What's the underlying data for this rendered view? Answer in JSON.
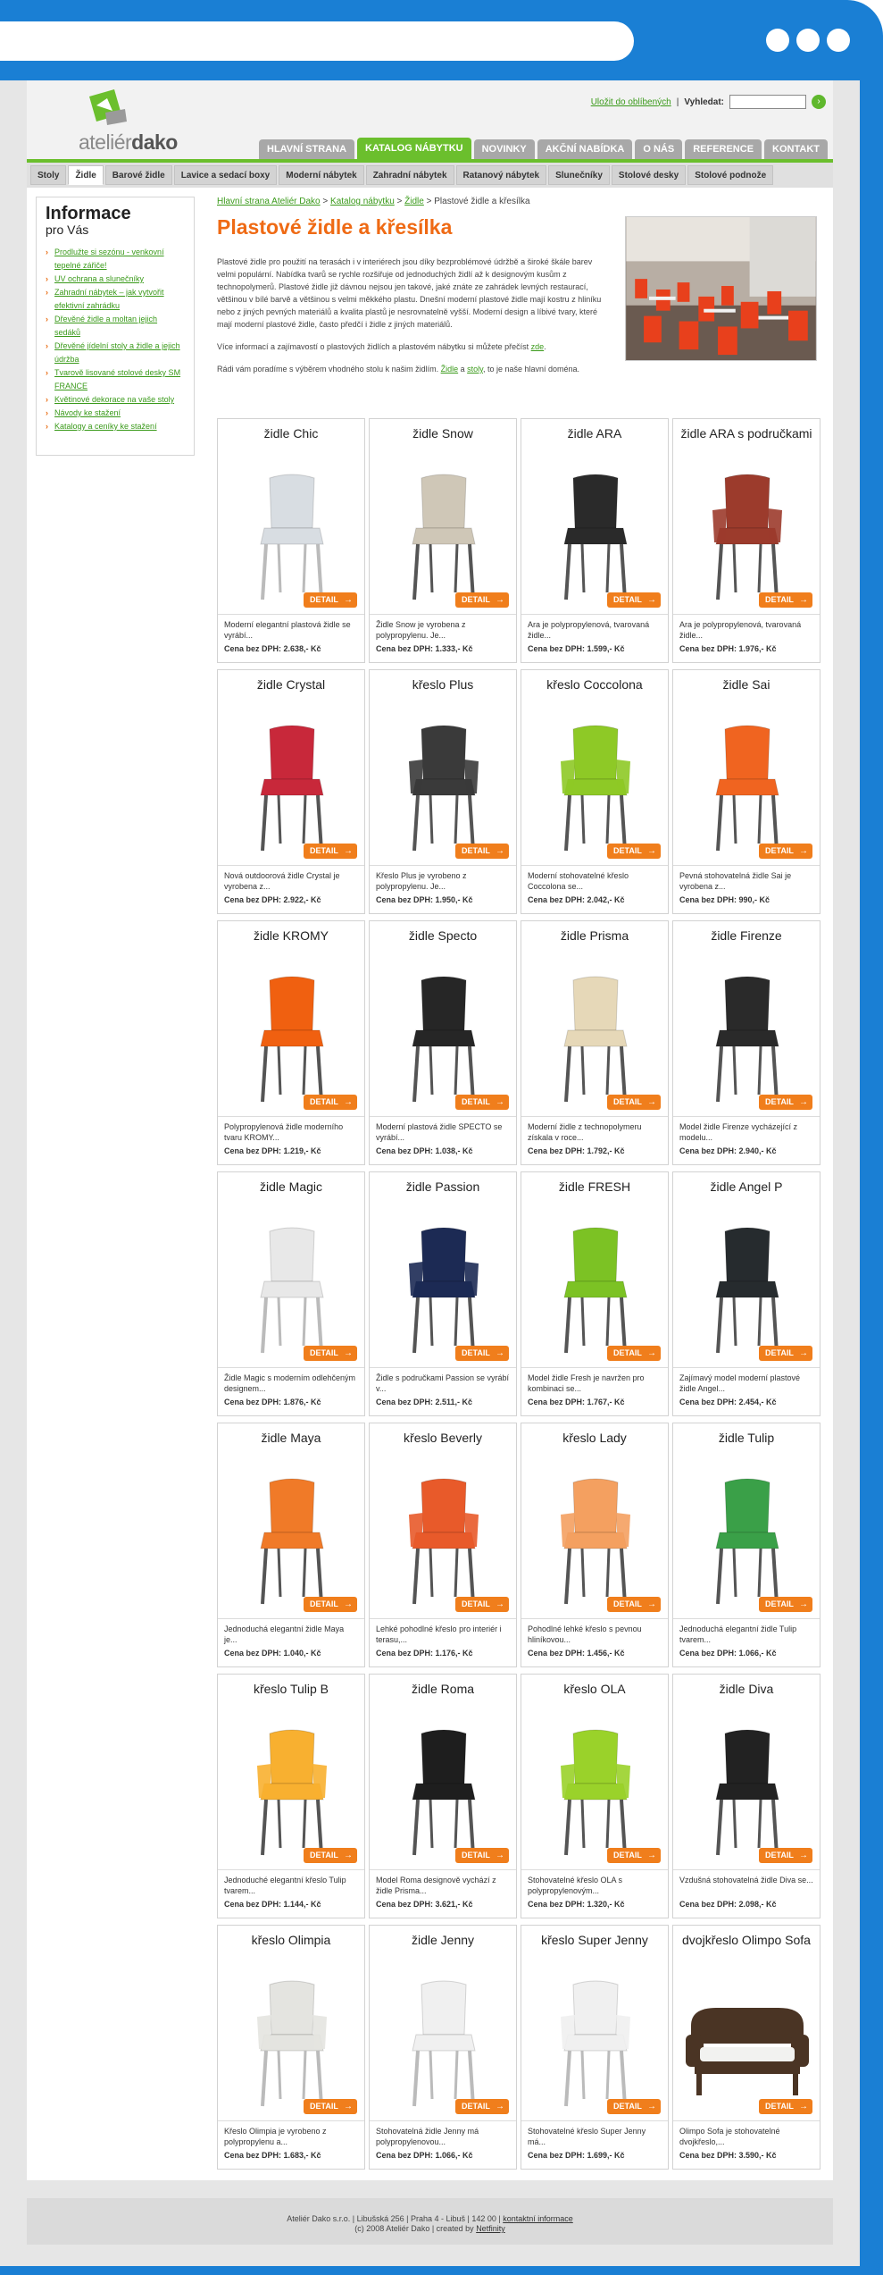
{
  "header": {
    "logo_part1": "ateliér",
    "logo_part2": "dako",
    "favorites_link": "Uložit do oblíbených",
    "separator": "|",
    "search_label": "Vyhledat:",
    "search_button": "›"
  },
  "main_nav": [
    "HLAVNÍ STRANA",
    "KATALOG NÁBYTKU",
    "NOVINKY",
    "AKČNÍ NABÍDKA",
    "O NÁS",
    "REFERENCE",
    "KONTAKT"
  ],
  "main_nav_active": "KATALOG NÁBYTKU",
  "sub_nav": [
    "Stoly",
    "Židle",
    "Barové židle",
    "Lavice a sedací boxy",
    "Moderní nábytek",
    "Zahradní nábytek",
    "Ratanový nábytek",
    "Slunečníky",
    "Stolové desky",
    "Stolové podnože"
  ],
  "sub_nav_active": "Židle",
  "sidebar": {
    "title": "Informace",
    "subtitle": "pro Vás",
    "links": [
      "Prodlužte si sezónu - venkovní tepelné zářiče!",
      "UV ochrana a slunečníky",
      "Zahradní nábytek – jak vytvořit efektivní zahrádku",
      "Dřevěné židle a moltan jejich sedáků",
      "Dřevěné jídelní stoly a židle a jejich údržba",
      "Tvarově lisované stolové desky SM FRANCE",
      "Květinové dekorace na vaše stoly",
      "Návody ke stažení",
      "Katalogy a ceníky ke stažení"
    ]
  },
  "breadcrumb": {
    "home": "Hlavní strana Ateliér Dako",
    "catalog": "Katalog nábytku",
    "category": "Židle",
    "current": "Plastové židle a křesílka",
    "sep": ">"
  },
  "page_title": "Plastové židle a křesílka",
  "intro": {
    "p1": "Plastové židle pro použití na terasách i v interiérech jsou díky bezproblémové údržbě a široké škále barev velmi populární. Nabídka tvarů se rychle rozšiřuje od jednoduchých židlí až k designovým kusům z technopolymerů. Plastové židle již dávnou nejsou jen takové, jaké znáte ze zahrádek levných restaurací, většinou v bílé barvě a většinou s velmi měkkého plastu. Dnešní moderní plastové židle mají kostru z hliníku nebo z jiných pevných materiálů a kvalita plastů je nesrovnatelně vyšší. Moderní design a líbivé tvary, které mají moderní plastové židle, často předčí i židle z jiných materiálů.",
    "p2_text": "Více informací a zajímavostí o plastových židlích a plastovém nábytku si můžete přečíst ",
    "p2_link": "zde",
    "p3_text": "Rádi vám poradíme s výběrem vhodného stolu k našim židlím. ",
    "p3_link1": "Židle",
    "p3_mid": " a ",
    "p3_link2": "stoly",
    "p3_end": ", to je naše hlavní doména."
  },
  "detail_label": "DETAIL",
  "price_label": "Cena bez DPH:",
  "products": [
    {
      "name": "židle Chic",
      "desc": "Moderní elegantní plastová židle se vyrábí...",
      "price": "2.638,- Kč",
      "color": "#d8dde2",
      "shape": "chair"
    },
    {
      "name": "židle Snow",
      "desc": "Židle Snow je vyrobena z polypropylenu. Je...",
      "price": "1.333,- Kč",
      "color": "#cfc7b7",
      "shape": "chair"
    },
    {
      "name": "židle ARA",
      "desc": "Ara je polypropylenová, tvarovaná židle...",
      "price": "1.599,- Kč",
      "color": "#2a2a2a",
      "shape": "chair"
    },
    {
      "name": "židle ARA s područkami",
      "desc": "Ara je polypropylenová, tvarovaná židle...",
      "price": "1.976,- Kč",
      "color": "#9c3b2c",
      "shape": "armchair"
    },
    {
      "name": "židle Crystal",
      "desc": "Nová outdoorová židle Crystal je vyrobena z...",
      "price": "2.922,- Kč",
      "color": "#c8283a",
      "shape": "chair"
    },
    {
      "name": "křeslo Plus",
      "desc": "Křeslo Plus je vyrobeno z polypropylenu. Je...",
      "price": "1.950,- Kč",
      "color": "#3a3a3a",
      "shape": "armchair"
    },
    {
      "name": "křeslo Coccolona",
      "desc": "Moderní stohovatelné křeslo Coccolona se...",
      "price": "2.042,- Kč",
      "color": "#8ec926",
      "shape": "armchair"
    },
    {
      "name": "židle Sai",
      "desc": "Pevná stohovatelná židle Sai je vyrobena z...",
      "price": "990,- Kč",
      "color": "#f06420",
      "shape": "chair"
    },
    {
      "name": "židle KROMY",
      "desc": "Polypropylenová židle moderního tvaru KROMY...",
      "price": "1.219,- Kč",
      "color": "#f06010",
      "shape": "chair"
    },
    {
      "name": "židle Specto",
      "desc": "Moderní plastová židle SPECTO se vyrábí...",
      "price": "1.038,- Kč",
      "color": "#262626",
      "shape": "chair"
    },
    {
      "name": "židle Prisma",
      "desc": "Moderní židle z technopolymeru získala v roce...",
      "price": "1.792,- Kč",
      "color": "#e6d8b8",
      "shape": "chair"
    },
    {
      "name": "židle Firenze",
      "desc": "Model židle Firenze vycházející z modelu...",
      "price": "2.940,- Kč",
      "color": "#2a2a2a",
      "shape": "chair"
    },
    {
      "name": "židle Magic",
      "desc": "Židle Magic s moderním odlehčeným designem...",
      "price": "1.876,- Kč",
      "color": "#e8e8e8",
      "shape": "chair"
    },
    {
      "name": "židle Passion",
      "desc": "Židle s područkami Passion se vyrábí v...",
      "price": "2.511,- Kč",
      "color": "#1c2a54",
      "shape": "armchair"
    },
    {
      "name": "židle FRESH",
      "desc": "Model židle Fresh je navržen pro kombinaci se...",
      "price": "1.767,- Kč",
      "color": "#7cc224",
      "shape": "chair"
    },
    {
      "name": "židle Angel P",
      "desc": "Zajímavý model moderní plastové židle Angel...",
      "price": "2.454,- Kč",
      "color": "#262b2e",
      "shape": "chair"
    },
    {
      "name": "židle Maya",
      "desc": "Jednoduchá elegantní židle Maya je...",
      "price": "1.040,- Kč",
      "color": "#f07a28",
      "shape": "chair"
    },
    {
      "name": "křeslo Beverly",
      "desc": "Lehké pohodlné křeslo pro interiér i terasu,...",
      "price": "1.176,- Kč",
      "color": "#e85a2a",
      "shape": "armchair"
    },
    {
      "name": "křeslo Lady",
      "desc": "Pohodlné lehké křeslo s pevnou hliníkovou...",
      "price": "1.456,- Kč",
      "color": "#f4a060",
      "shape": "armchair"
    },
    {
      "name": "židle Tulip",
      "desc": "Jednoduchá elegantní židle Tulip tvarem...",
      "price": "1.066,- Kč",
      "color": "#3aa048",
      "shape": "chair"
    },
    {
      "name": "křeslo Tulip B",
      "desc": "Jednoduché elegantní křeslo Tulip tvarem...",
      "price": "1.144,- Kč",
      "color": "#f8b030",
      "shape": "armchair"
    },
    {
      "name": "židle Roma",
      "desc": "Model Roma designově vychází z židle Prisma...",
      "price": "3.621,- Kč",
      "color": "#1e1e1e",
      "shape": "chair"
    },
    {
      "name": "křeslo OLA",
      "desc": "Stohovatelné křeslo OLA s polypropylenovým...",
      "price": "1.320,- Kč",
      "color": "#9ad22a",
      "shape": "armchair"
    },
    {
      "name": "židle Diva",
      "desc": "Vzdušná stohovatelná židle Diva se...",
      "price": "2.098,- Kč",
      "color": "#222222",
      "shape": "chair"
    },
    {
      "name": "křeslo Olimpia",
      "desc": "Křeslo Olimpia je vyrobeno z polypropylenu a...",
      "price": "1.683,- Kč",
      "color": "#e4e4e0",
      "shape": "armchair"
    },
    {
      "name": "židle Jenny",
      "desc": "Stohovatelná židle Jenny má polypropylenovou...",
      "price": "1.066,- Kč",
      "color": "#f0f0f0",
      "shape": "chair"
    },
    {
      "name": "křeslo Super Jenny",
      "desc": "Stohovatelné křeslo Super Jenny má...",
      "price": "1.699,- Kč",
      "color": "#f0f0f0",
      "shape": "armchair"
    },
    {
      "name": "dvojkřeslo Olimpo Sofa",
      "desc": "Olimpo Sofa je stohovatelné dvojkřeslo,...",
      "price": "3.590,- Kč",
      "color": "#4a3424",
      "shape": "sofa"
    }
  ],
  "footer": {
    "line1": "Ateliér Dako s.r.o. | Libušská 256 | Praha 4 - Libuš | 142 00 | ",
    "contact_link": "kontaktní informace",
    "line2": "(c) 2008 Ateliér Dako | created by ",
    "creator_link": "Netfinity"
  },
  "colors": {
    "frame": "#1a7fd4",
    "accent_green": "#6bbf2d",
    "accent_orange": "#ef6a14"
  }
}
